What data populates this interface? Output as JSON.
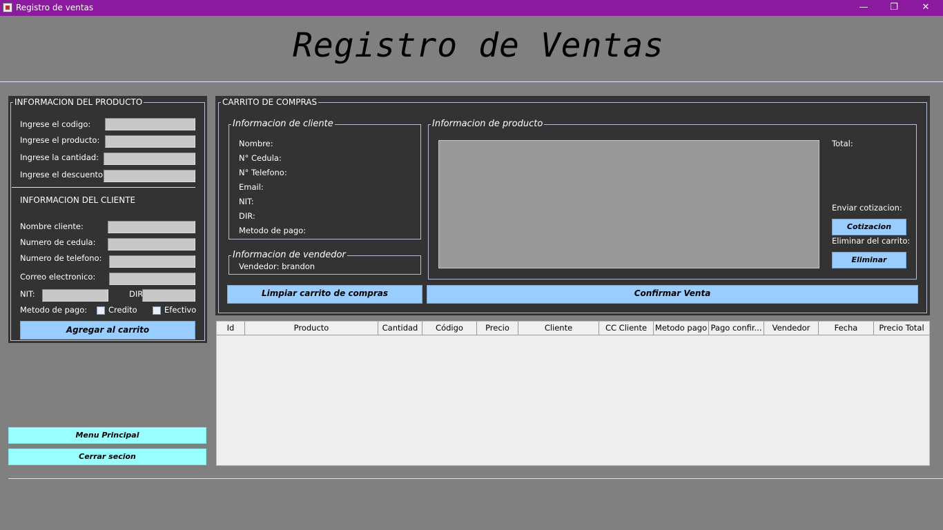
{
  "window": {
    "title": "Registro de ventas",
    "minimize_glyph": "—",
    "maximize_glyph": "❐",
    "close_glyph": "✕"
  },
  "header": {
    "title": "Registro de Ventas"
  },
  "product_info": {
    "legend": "INFORMACION DEL PRODUCTO",
    "codigo_label": "Ingrese el codigo:",
    "producto_label": "Ingrese el producto:",
    "cantidad_label": "Ingrese la cantidad:",
    "descuento_label": "Ingrese el descuento:",
    "codigo_value": "",
    "producto_value": "",
    "cantidad_value": "",
    "descuento_value": ""
  },
  "client_info": {
    "heading": "INFORMACION DEL CLIENTE",
    "nombre_label": "Nombre cliente:",
    "cedula_label": "Numero de cedula:",
    "telefono_label": "Numero de telefono:",
    "correo_label": "Correo electronico:",
    "nit_label": "NIT:",
    "dir_label": "DIR:",
    "metodo_label": "Metodo de pago:",
    "credito_label": "Credito",
    "efectivo_label": "Efectivo",
    "nombre_value": "",
    "cedula_value": "",
    "telefono_value": "",
    "correo_value": "",
    "nit_value": "",
    "dir_value": "",
    "credito_checked": false,
    "efectivo_checked": false,
    "add_button": "Agregar al carrito"
  },
  "nav": {
    "menu_principal": "Menu Principal",
    "cerrar_sesion": "Cerrar secion"
  },
  "cart": {
    "legend": "CARRITO DE COMPRAS",
    "client_legend": "Informacion de cliente",
    "nombre": "Nombre:",
    "cedula": "N° Cedula:",
    "telefono": "N° Telefono:",
    "email": "Email:",
    "nit": "NIT:",
    "dir": "DIR:",
    "metodo_pago": "Metodo de pago:",
    "vendor_legend": "Informacion de vendedor",
    "vendedor": "Vendedor: brandon",
    "product_legend": "Informacion de producto",
    "total": "Total:",
    "enviar_cotizacion": "Enviar cotizacion:",
    "cotizacion_button": "Cotizacion",
    "eliminar_label": "Eliminar del carrito:",
    "eliminar_button": "Eliminar",
    "limpiar_button": "Limpiar carrito de compras",
    "confirmar_button": "Confirmar Venta"
  },
  "table": {
    "columns": [
      "Id",
      "Producto",
      "Cantidad",
      "Código",
      "Precio",
      "Cliente",
      "CC Cliente",
      "Metodo pago",
      "Pago confir...",
      "Vendedor",
      "Fecha",
      "Precio Total"
    ],
    "rows": []
  },
  "colors": {
    "titlebar": "#8b1a9e",
    "background": "#808080",
    "panel": "#333333",
    "button": "#99ccff",
    "nav_button": "#99ffff"
  }
}
